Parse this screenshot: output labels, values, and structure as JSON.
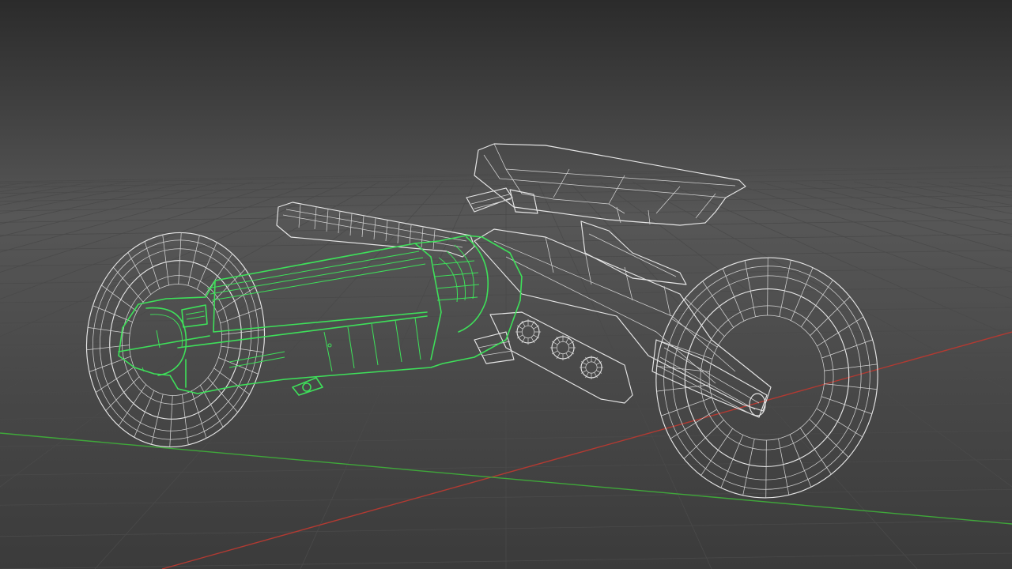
{
  "viewport": {
    "view": "perspective",
    "display_mode": "wireframe",
    "background_gradient": [
      "#2b2b2b",
      "#575757",
      "#3b3b3b"
    ]
  },
  "grid": {
    "line_color": "#4a4a4a",
    "axis_x_color": "#b23a32",
    "axis_z_color": "#3fa83a"
  },
  "scene": {
    "object": "motorcycle",
    "wire_color": "#e6e6e6",
    "selection_color": "#3ee05a",
    "selected_part": "body-fairing"
  }
}
